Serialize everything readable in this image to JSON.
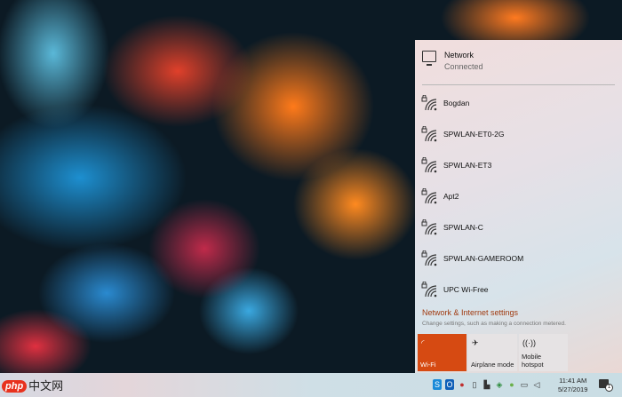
{
  "network": {
    "title": "Network",
    "status": "Connected"
  },
  "wifi_networks": [
    {
      "name": "Bogdan",
      "secured": true
    },
    {
      "name": "SPWLAN-ET0-2G",
      "secured": true
    },
    {
      "name": "SPWLAN-ET3",
      "secured": true
    },
    {
      "name": "Apt2",
      "secured": true
    },
    {
      "name": "SPWLAN-C",
      "secured": true
    },
    {
      "name": "SPWLAN-GAMEROOM",
      "secured": true
    },
    {
      "name": "UPC Wi-Free",
      "secured": true
    }
  ],
  "settings": {
    "link": "Network & Internet settings",
    "description": "Change settings, such as making a connection metered."
  },
  "quick_actions": [
    {
      "label": "Wi-Fi",
      "active": true
    },
    {
      "label": "Airplane mode",
      "active": false
    },
    {
      "label": "Mobile hotspot",
      "active": false
    }
  ],
  "taskbar": {
    "time": "11:41 AM",
    "date": "5/27/2019",
    "notification_count": "1",
    "tray_icons": [
      "skype-icon",
      "outlook-icon",
      "app-icon",
      "usb-icon",
      "printer-icon",
      "shield-icon",
      "chat-icon",
      "network-icon",
      "volume-icon"
    ]
  },
  "watermark": {
    "logo": "php",
    "text": "中文网"
  },
  "accent": "#d64a12"
}
